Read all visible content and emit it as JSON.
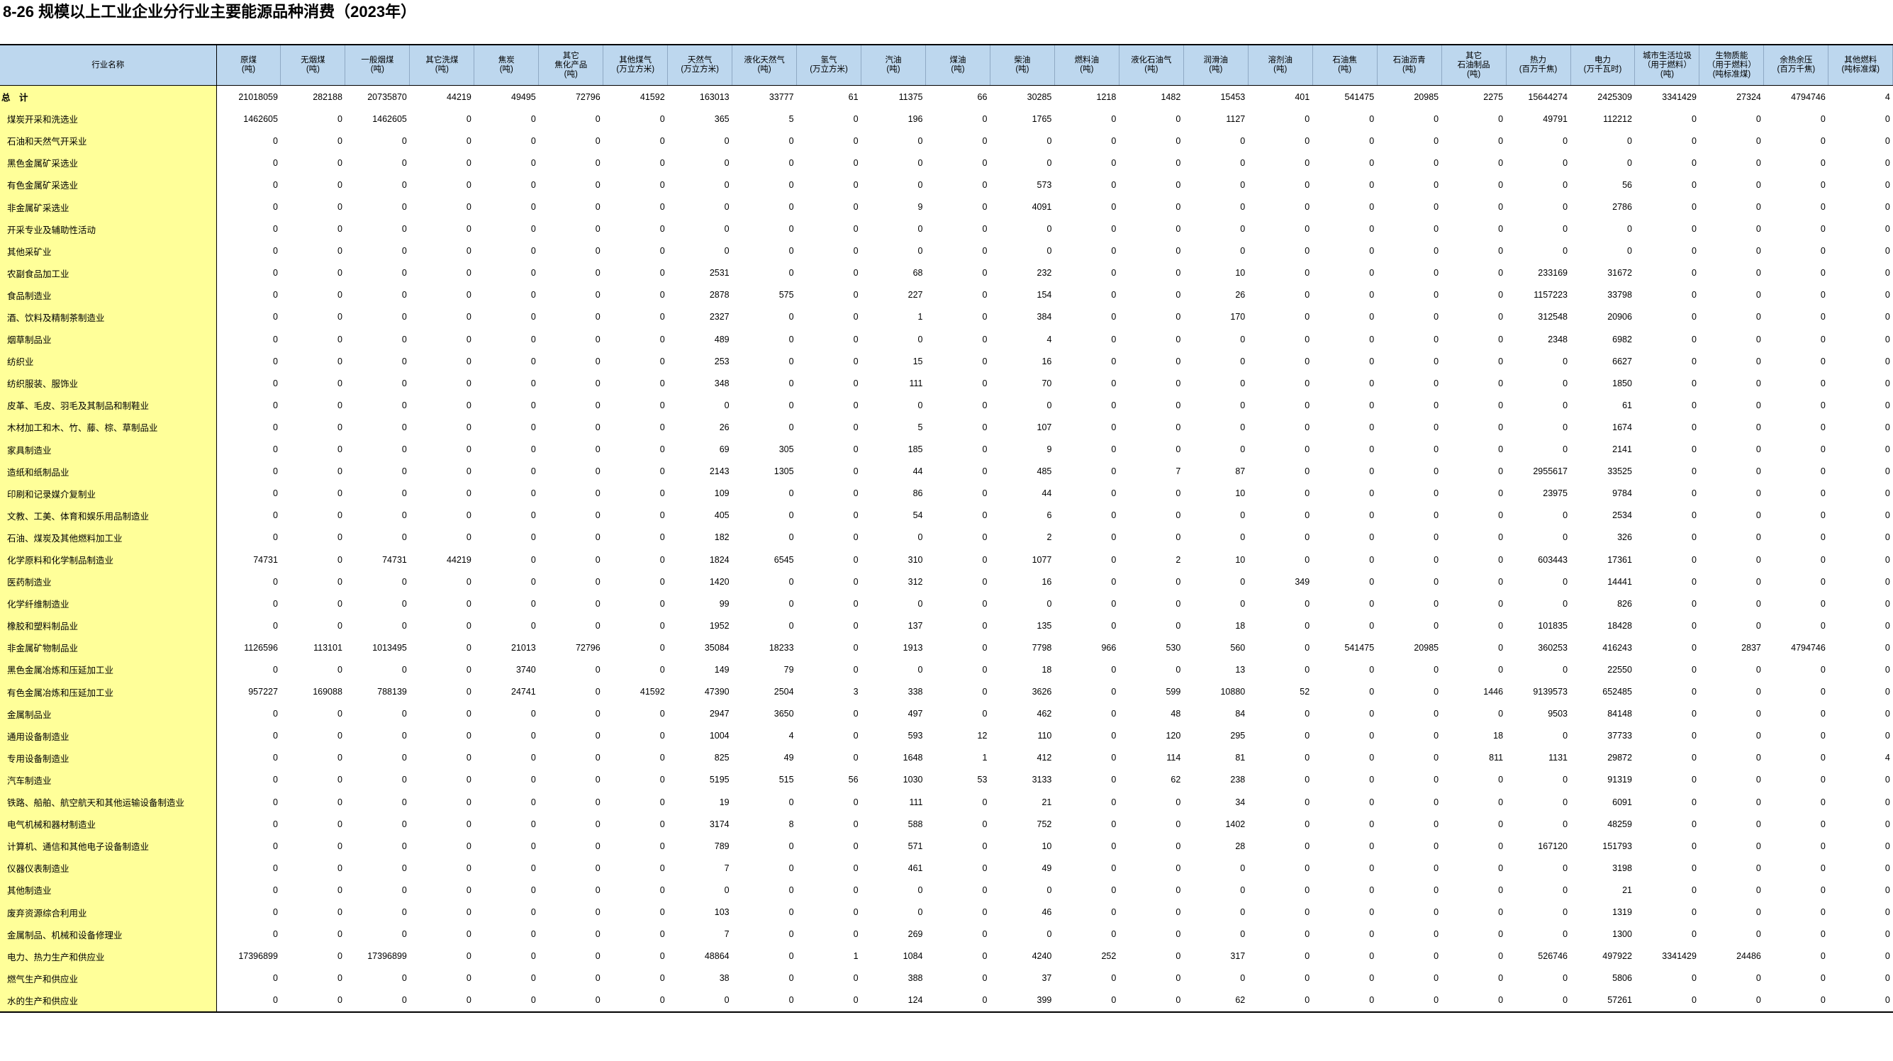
{
  "title": "8-26 规模以上工业企业分行业主要能源品种消费（2023年）",
  "table": {
    "headers": [
      "行业名称",
      "原煤\n(吨)",
      "无烟煤\n(吨)",
      "一般烟煤\n(吨)",
      "其它洗煤\n(吨)",
      "焦炭\n(吨)",
      "其它\n焦化产品\n(吨)",
      "其他煤气\n(万立方米)",
      "天然气\n(万立方米)",
      "液化天然气\n(吨)",
      "氢气\n(万立方米)",
      "汽油\n(吨)",
      "煤油\n(吨)",
      "柴油\n(吨)",
      "燃料油\n(吨)",
      "液化石油气\n(吨)",
      "润滑油\n(吨)",
      "溶剂油\n(吨)",
      "石油焦\n(吨)",
      "石油沥青\n(吨)",
      "其它\n石油制品\n(吨)",
      "热力\n(百万千焦)",
      "电力\n(万千瓦时)",
      "城市生活垃圾\n（用于燃料）\n(吨)",
      "生物质能\n（用于燃料）\n(吨标准煤)",
      "余热余压\n(百万千焦)",
      "其他燃料\n(吨标准煤)"
    ],
    "rows": [
      [
        "总　计",
        "21018059",
        "282188",
        "20735870",
        "44219",
        "49495",
        "72796",
        "41592",
        "163013",
        "33777",
        "61",
        "11375",
        "66",
        "30285",
        "1218",
        "1482",
        "15453",
        "401",
        "541475",
        "20985",
        "2275",
        "15644274",
        "2425309",
        "3341429",
        "27324",
        "4794746",
        "4"
      ],
      [
        "煤炭开采和洗选业",
        "1462605",
        "0",
        "1462605",
        "0",
        "0",
        "0",
        "0",
        "365",
        "5",
        "0",
        "196",
        "0",
        "1765",
        "0",
        "0",
        "1127",
        "0",
        "0",
        "0",
        "0",
        "49791",
        "112212",
        "0",
        "0",
        "0",
        "0"
      ],
      [
        "石油和天然气开采业",
        "0",
        "0",
        "0",
        "0",
        "0",
        "0",
        "0",
        "0",
        "0",
        "0",
        "0",
        "0",
        "0",
        "0",
        "0",
        "0",
        "0",
        "0",
        "0",
        "0",
        "0",
        "0",
        "0",
        "0",
        "0",
        "0"
      ],
      [
        "黑色金属矿采选业",
        "0",
        "0",
        "0",
        "0",
        "0",
        "0",
        "0",
        "0",
        "0",
        "0",
        "0",
        "0",
        "0",
        "0",
        "0",
        "0",
        "0",
        "0",
        "0",
        "0",
        "0",
        "0",
        "0",
        "0",
        "0",
        "0"
      ],
      [
        "有色金属矿采选业",
        "0",
        "0",
        "0",
        "0",
        "0",
        "0",
        "0",
        "0",
        "0",
        "0",
        "0",
        "0",
        "573",
        "0",
        "0",
        "0",
        "0",
        "0",
        "0",
        "0",
        "0",
        "56",
        "0",
        "0",
        "0",
        "0"
      ],
      [
        "非金属矿采选业",
        "0",
        "0",
        "0",
        "0",
        "0",
        "0",
        "0",
        "0",
        "0",
        "0",
        "9",
        "0",
        "4091",
        "0",
        "0",
        "0",
        "0",
        "0",
        "0",
        "0",
        "0",
        "2786",
        "0",
        "0",
        "0",
        "0"
      ],
      [
        "开采专业及辅助性活动",
        "0",
        "0",
        "0",
        "0",
        "0",
        "0",
        "0",
        "0",
        "0",
        "0",
        "0",
        "0",
        "0",
        "0",
        "0",
        "0",
        "0",
        "0",
        "0",
        "0",
        "0",
        "0",
        "0",
        "0",
        "0",
        "0"
      ],
      [
        "其他采矿业",
        "0",
        "0",
        "0",
        "0",
        "0",
        "0",
        "0",
        "0",
        "0",
        "0",
        "0",
        "0",
        "0",
        "0",
        "0",
        "0",
        "0",
        "0",
        "0",
        "0",
        "0",
        "0",
        "0",
        "0",
        "0",
        "0"
      ],
      [
        "农副食品加工业",
        "0",
        "0",
        "0",
        "0",
        "0",
        "0",
        "0",
        "2531",
        "0",
        "0",
        "68",
        "0",
        "232",
        "0",
        "0",
        "10",
        "0",
        "0",
        "0",
        "0",
        "233169",
        "31672",
        "0",
        "0",
        "0",
        "0"
      ],
      [
        "食品制造业",
        "0",
        "0",
        "0",
        "0",
        "0",
        "0",
        "0",
        "2878",
        "575",
        "0",
        "227",
        "0",
        "154",
        "0",
        "0",
        "26",
        "0",
        "0",
        "0",
        "0",
        "1157223",
        "33798",
        "0",
        "0",
        "0",
        "0"
      ],
      [
        "酒、饮料及精制茶制造业",
        "0",
        "0",
        "0",
        "0",
        "0",
        "0",
        "0",
        "2327",
        "0",
        "0",
        "1",
        "0",
        "384",
        "0",
        "0",
        "170",
        "0",
        "0",
        "0",
        "0",
        "312548",
        "20906",
        "0",
        "0",
        "0",
        "0"
      ],
      [
        "烟草制品业",
        "0",
        "0",
        "0",
        "0",
        "0",
        "0",
        "0",
        "489",
        "0",
        "0",
        "0",
        "0",
        "4",
        "0",
        "0",
        "0",
        "0",
        "0",
        "0",
        "0",
        "2348",
        "6982",
        "0",
        "0",
        "0",
        "0"
      ],
      [
        "纺织业",
        "0",
        "0",
        "0",
        "0",
        "0",
        "0",
        "0",
        "253",
        "0",
        "0",
        "15",
        "0",
        "16",
        "0",
        "0",
        "0",
        "0",
        "0",
        "0",
        "0",
        "0",
        "6627",
        "0",
        "0",
        "0",
        "0"
      ],
      [
        "纺织服装、服饰业",
        "0",
        "0",
        "0",
        "0",
        "0",
        "0",
        "0",
        "348",
        "0",
        "0",
        "111",
        "0",
        "70",
        "0",
        "0",
        "0",
        "0",
        "0",
        "0",
        "0",
        "0",
        "1850",
        "0",
        "0",
        "0",
        "0"
      ],
      [
        "皮革、毛皮、羽毛及其制品和制鞋业",
        "0",
        "0",
        "0",
        "0",
        "0",
        "0",
        "0",
        "0",
        "0",
        "0",
        "0",
        "0",
        "0",
        "0",
        "0",
        "0",
        "0",
        "0",
        "0",
        "0",
        "0",
        "61",
        "0",
        "0",
        "0",
        "0"
      ],
      [
        "木材加工和木、竹、藤、棕、草制品业",
        "0",
        "0",
        "0",
        "0",
        "0",
        "0",
        "0",
        "26",
        "0",
        "0",
        "5",
        "0",
        "107",
        "0",
        "0",
        "0",
        "0",
        "0",
        "0",
        "0",
        "0",
        "1674",
        "0",
        "0",
        "0",
        "0"
      ],
      [
        "家具制造业",
        "0",
        "0",
        "0",
        "0",
        "0",
        "0",
        "0",
        "69",
        "305",
        "0",
        "185",
        "0",
        "9",
        "0",
        "0",
        "0",
        "0",
        "0",
        "0",
        "0",
        "0",
        "2141",
        "0",
        "0",
        "0",
        "0"
      ],
      [
        "造纸和纸制品业",
        "0",
        "0",
        "0",
        "0",
        "0",
        "0",
        "0",
        "2143",
        "1305",
        "0",
        "44",
        "0",
        "485",
        "0",
        "7",
        "87",
        "0",
        "0",
        "0",
        "0",
        "2955617",
        "33525",
        "0",
        "0",
        "0",
        "0"
      ],
      [
        "印刷和记录媒介复制业",
        "0",
        "0",
        "0",
        "0",
        "0",
        "0",
        "0",
        "109",
        "0",
        "0",
        "86",
        "0",
        "44",
        "0",
        "0",
        "10",
        "0",
        "0",
        "0",
        "0",
        "23975",
        "9784",
        "0",
        "0",
        "0",
        "0"
      ],
      [
        "文教、工美、体育和娱乐用品制造业",
        "0",
        "0",
        "0",
        "0",
        "0",
        "0",
        "0",
        "405",
        "0",
        "0",
        "54",
        "0",
        "6",
        "0",
        "0",
        "0",
        "0",
        "0",
        "0",
        "0",
        "0",
        "2534",
        "0",
        "0",
        "0",
        "0"
      ],
      [
        "石油、煤炭及其他燃料加工业",
        "0",
        "0",
        "0",
        "0",
        "0",
        "0",
        "0",
        "182",
        "0",
        "0",
        "0",
        "0",
        "2",
        "0",
        "0",
        "0",
        "0",
        "0",
        "0",
        "0",
        "0",
        "326",
        "0",
        "0",
        "0",
        "0"
      ],
      [
        "化学原料和化学制品制造业",
        "74731",
        "0",
        "74731",
        "44219",
        "0",
        "0",
        "0",
        "1824",
        "6545",
        "0",
        "310",
        "0",
        "1077",
        "0",
        "2",
        "10",
        "0",
        "0",
        "0",
        "0",
        "603443",
        "17361",
        "0",
        "0",
        "0",
        "0"
      ],
      [
        "医药制造业",
        "0",
        "0",
        "0",
        "0",
        "0",
        "0",
        "0",
        "1420",
        "0",
        "0",
        "312",
        "0",
        "16",
        "0",
        "0",
        "0",
        "349",
        "0",
        "0",
        "0",
        "0",
        "14441",
        "0",
        "0",
        "0",
        "0"
      ],
      [
        "化学纤维制造业",
        "0",
        "0",
        "0",
        "0",
        "0",
        "0",
        "0",
        "99",
        "0",
        "0",
        "0",
        "0",
        "0",
        "0",
        "0",
        "0",
        "0",
        "0",
        "0",
        "0",
        "0",
        "826",
        "0",
        "0",
        "0",
        "0"
      ],
      [
        "橡胶和塑料制品业",
        "0",
        "0",
        "0",
        "0",
        "0",
        "0",
        "0",
        "1952",
        "0",
        "0",
        "137",
        "0",
        "135",
        "0",
        "0",
        "18",
        "0",
        "0",
        "0",
        "0",
        "101835",
        "18428",
        "0",
        "0",
        "0",
        "0"
      ],
      [
        "非金属矿物制品业",
        "1126596",
        "113101",
        "1013495",
        "0",
        "21013",
        "72796",
        "0",
        "35084",
        "18233",
        "0",
        "1913",
        "0",
        "7798",
        "966",
        "530",
        "560",
        "0",
        "541475",
        "20985",
        "0",
        "360253",
        "416243",
        "0",
        "2837",
        "4794746",
        "0"
      ],
      [
        "黑色金属冶炼和压延加工业",
        "0",
        "0",
        "0",
        "0",
        "3740",
        "0",
        "0",
        "149",
        "79",
        "0",
        "0",
        "0",
        "18",
        "0",
        "0",
        "13",
        "0",
        "0",
        "0",
        "0",
        "0",
        "22550",
        "0",
        "0",
        "0",
        "0"
      ],
      [
        "有色金属冶炼和压延加工业",
        "957227",
        "169088",
        "788139",
        "0",
        "24741",
        "0",
        "41592",
        "47390",
        "2504",
        "3",
        "338",
        "0",
        "3626",
        "0",
        "599",
        "10880",
        "52",
        "0",
        "0",
        "1446",
        "9139573",
        "652485",
        "0",
        "0",
        "0",
        "0"
      ],
      [
        "金属制品业",
        "0",
        "0",
        "0",
        "0",
        "0",
        "0",
        "0",
        "2947",
        "3650",
        "0",
        "497",
        "0",
        "462",
        "0",
        "48",
        "84",
        "0",
        "0",
        "0",
        "0",
        "9503",
        "84148",
        "0",
        "0",
        "0",
        "0"
      ],
      [
        "通用设备制造业",
        "0",
        "0",
        "0",
        "0",
        "0",
        "0",
        "0",
        "1004",
        "4",
        "0",
        "593",
        "12",
        "110",
        "0",
        "120",
        "295",
        "0",
        "0",
        "0",
        "18",
        "0",
        "37733",
        "0",
        "0",
        "0",
        "0"
      ],
      [
        "专用设备制造业",
        "0",
        "0",
        "0",
        "0",
        "0",
        "0",
        "0",
        "825",
        "49",
        "0",
        "1648",
        "1",
        "412",
        "0",
        "114",
        "81",
        "0",
        "0",
        "0",
        "811",
        "1131",
        "29872",
        "0",
        "0",
        "0",
        "4"
      ],
      [
        "汽车制造业",
        "0",
        "0",
        "0",
        "0",
        "0",
        "0",
        "0",
        "5195",
        "515",
        "56",
        "1030",
        "53",
        "3133",
        "0",
        "62",
        "238",
        "0",
        "0",
        "0",
        "0",
        "0",
        "91319",
        "0",
        "0",
        "0",
        "0"
      ],
      [
        "铁路、船舶、航空航天和其他运输设备制造业",
        "0",
        "0",
        "0",
        "0",
        "0",
        "0",
        "0",
        "19",
        "0",
        "0",
        "111",
        "0",
        "21",
        "0",
        "0",
        "34",
        "0",
        "0",
        "0",
        "0",
        "0",
        "6091",
        "0",
        "0",
        "0",
        "0"
      ],
      [
        "电气机械和器材制造业",
        "0",
        "0",
        "0",
        "0",
        "0",
        "0",
        "0",
        "3174",
        "8",
        "0",
        "588",
        "0",
        "752",
        "0",
        "0",
        "1402",
        "0",
        "0",
        "0",
        "0",
        "0",
        "48259",
        "0",
        "0",
        "0",
        "0"
      ],
      [
        "计算机、通信和其他电子设备制造业",
        "0",
        "0",
        "0",
        "0",
        "0",
        "0",
        "0",
        "789",
        "0",
        "0",
        "571",
        "0",
        "10",
        "0",
        "0",
        "28",
        "0",
        "0",
        "0",
        "0",
        "167120",
        "151793",
        "0",
        "0",
        "0",
        "0"
      ],
      [
        "仪器仪表制造业",
        "0",
        "0",
        "0",
        "0",
        "0",
        "0",
        "0",
        "7",
        "0",
        "0",
        "461",
        "0",
        "49",
        "0",
        "0",
        "0",
        "0",
        "0",
        "0",
        "0",
        "0",
        "3198",
        "0",
        "0",
        "0",
        "0"
      ],
      [
        "其他制造业",
        "0",
        "0",
        "0",
        "0",
        "0",
        "0",
        "0",
        "0",
        "0",
        "0",
        "0",
        "0",
        "0",
        "0",
        "0",
        "0",
        "0",
        "0",
        "0",
        "0",
        "0",
        "21",
        "0",
        "0",
        "0",
        "0"
      ],
      [
        "废弃资源综合利用业",
        "0",
        "0",
        "0",
        "0",
        "0",
        "0",
        "0",
        "103",
        "0",
        "0",
        "0",
        "0",
        "46",
        "0",
        "0",
        "0",
        "0",
        "0",
        "0",
        "0",
        "0",
        "1319",
        "0",
        "0",
        "0",
        "0"
      ],
      [
        "金属制品、机械和设备修理业",
        "0",
        "0",
        "0",
        "0",
        "0",
        "0",
        "0",
        "7",
        "0",
        "0",
        "269",
        "0",
        "0",
        "0",
        "0",
        "0",
        "0",
        "0",
        "0",
        "0",
        "0",
        "1300",
        "0",
        "0",
        "0",
        "0"
      ],
      [
        "电力、热力生产和供应业",
        "17396899",
        "0",
        "17396899",
        "0",
        "0",
        "0",
        "0",
        "48864",
        "0",
        "1",
        "1084",
        "0",
        "4240",
        "252",
        "0",
        "317",
        "0",
        "0",
        "0",
        "0",
        "526746",
        "497922",
        "3341429",
        "24486",
        "0",
        "0"
      ],
      [
        "燃气生产和供应业",
        "0",
        "0",
        "0",
        "0",
        "0",
        "0",
        "0",
        "38",
        "0",
        "0",
        "388",
        "0",
        "37",
        "0",
        "0",
        "0",
        "0",
        "0",
        "0",
        "0",
        "0",
        "5806",
        "0",
        "0",
        "0",
        "0"
      ],
      [
        "水的生产和供应业",
        "0",
        "0",
        "0",
        "0",
        "0",
        "0",
        "0",
        "0",
        "0",
        "0",
        "124",
        "0",
        "399",
        "0",
        "0",
        "62",
        "0",
        "0",
        "0",
        "0",
        "0",
        "57261",
        "0",
        "0",
        "0",
        "0"
      ]
    ]
  }
}
